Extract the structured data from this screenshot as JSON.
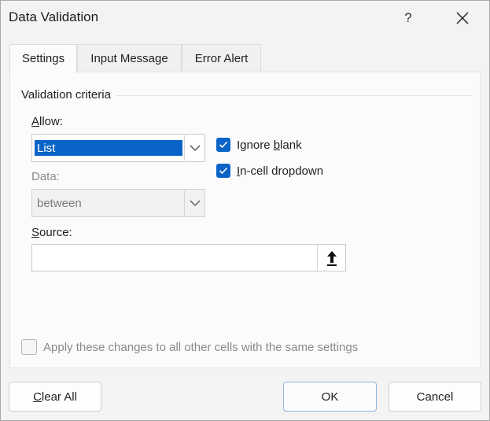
{
  "dialog": {
    "title": "Data Validation",
    "help_label": "?"
  },
  "tabs": [
    {
      "label": "Settings",
      "active": true
    },
    {
      "label": "Input Message",
      "active": false
    },
    {
      "label": "Error Alert",
      "active": false
    }
  ],
  "settings": {
    "group_label": "Validation criteria",
    "allow": {
      "label_accel": "A",
      "label_rest": "llow:",
      "value": "List"
    },
    "data": {
      "label": "Data:",
      "value": "between"
    },
    "ignore_blank": {
      "label_pre": "Ignore ",
      "label_accel": "b",
      "label_post": "lank",
      "checked": true
    },
    "in_cell_dropdown": {
      "label_accel": "I",
      "label_rest": "n-cell dropdown",
      "checked": true
    },
    "source": {
      "label_accel": "S",
      "label_rest": "ource:",
      "value": ""
    },
    "apply_all": {
      "label": "Apply these changes to all other cells with the same settings",
      "checked": false
    }
  },
  "buttons": {
    "clear_all": {
      "accel": "C",
      "rest": "lear All"
    },
    "ok": "OK",
    "cancel": "Cancel"
  },
  "icons": {
    "close": "close-icon",
    "dropdown": "chevron-down-icon",
    "checkmark": "checkmark-icon",
    "collapse": "arrow-up-icon"
  },
  "colors": {
    "accent": "#0a64c7",
    "dialog_bg": "#f3f3f3",
    "panel_bg": "#fbfbfb"
  }
}
